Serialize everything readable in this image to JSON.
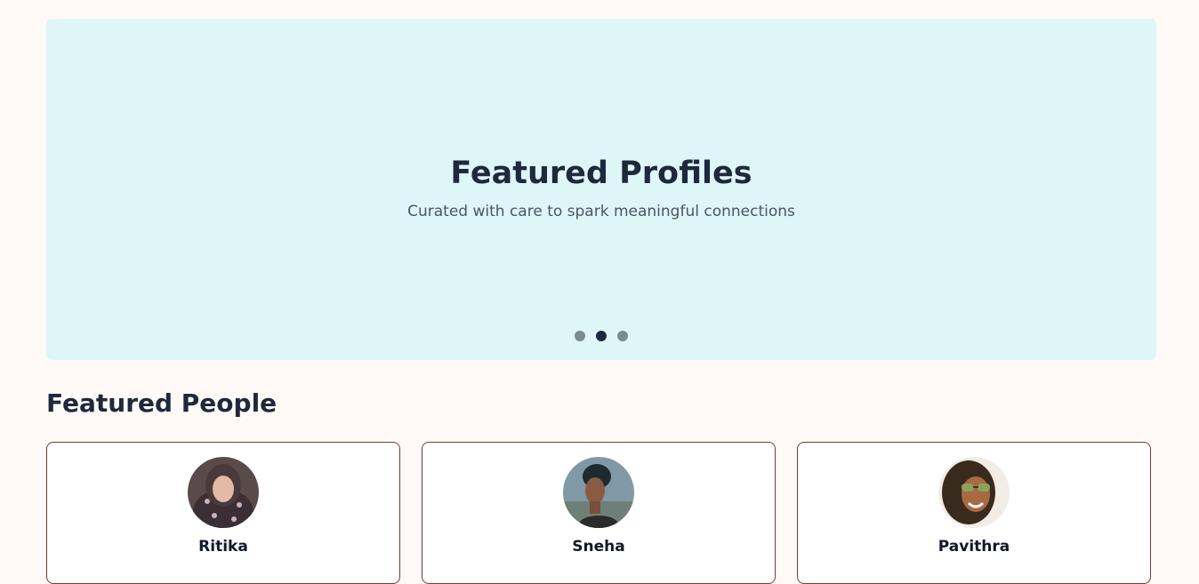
{
  "hero": {
    "title": "Featured Profiles",
    "subtitle": "Curated with care to spark meaningful connections",
    "background_color": "#dff6f8",
    "carousel": {
      "slide_count": 3,
      "active_index": 1
    }
  },
  "featured_people": {
    "heading": "Featured People",
    "people": [
      {
        "name": "Ritika",
        "avatar_icon": "profile-photo"
      },
      {
        "name": "Sneha",
        "avatar_icon": "profile-photo"
      },
      {
        "name": "Pavithra",
        "avatar_icon": "profile-photo"
      }
    ]
  },
  "colors": {
    "page_background": "#fffaf7",
    "card_border": "#7a3b2e",
    "text_dark": "#1e293b"
  }
}
